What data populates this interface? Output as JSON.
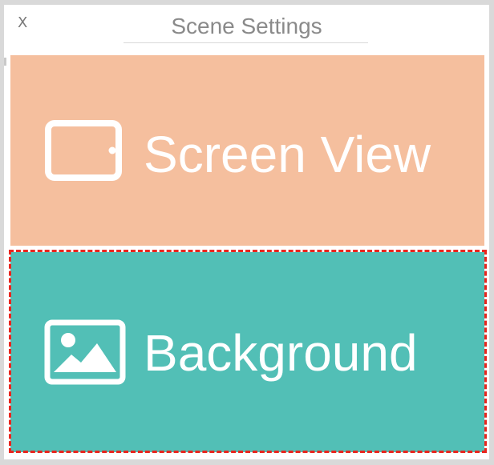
{
  "dialog": {
    "title": "Scene Settings",
    "close_label": "X"
  },
  "options": [
    {
      "label": "Screen View",
      "icon": "tablet-icon",
      "color": "#f5bf9e"
    },
    {
      "label": "Background",
      "icon": "image-icon",
      "color": "#52bfb6"
    }
  ],
  "highlight_color": "#e8261e"
}
